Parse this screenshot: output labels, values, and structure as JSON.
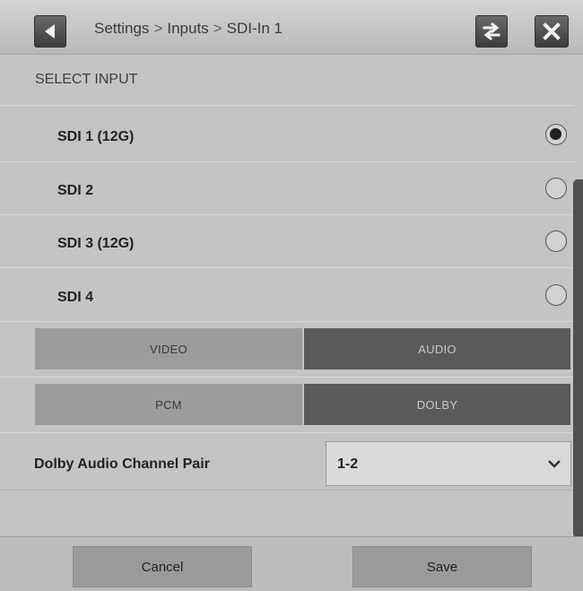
{
  "header": {
    "breadcrumb": [
      "Settings",
      "Inputs",
      "SDI-In 1"
    ],
    "separator": ">"
  },
  "section": {
    "title": "SELECT INPUT"
  },
  "inputs": [
    {
      "label": "SDI 1 (12G)",
      "selected": true
    },
    {
      "label": "SDI 2",
      "selected": false
    },
    {
      "label": "SDI 3 (12G)",
      "selected": false
    },
    {
      "label": "SDI 4",
      "selected": false
    }
  ],
  "mode_toggle": {
    "video_label": "VIDEO",
    "audio_label": "AUDIO",
    "active": "AUDIO"
  },
  "audio_toggle": {
    "pcm_label": "PCM",
    "dolby_label": "DOLBY",
    "active": "DOLBY"
  },
  "dolby_pair": {
    "label": "Dolby Audio Channel Pair",
    "value": "1-2"
  },
  "footer": {
    "cancel_label": "Cancel",
    "save_label": "Save"
  },
  "icons": {
    "back": "back-arrow-icon",
    "swap": "swap-arrows-icon",
    "close": "close-icon",
    "dropdown": "chevron-down-icon"
  }
}
